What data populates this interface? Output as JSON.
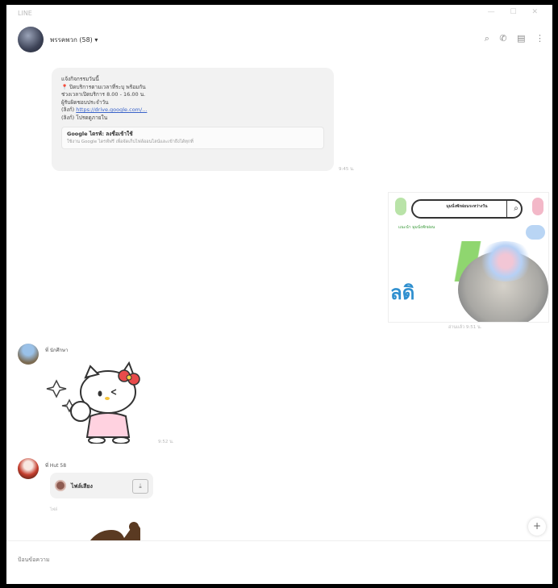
{
  "window": {
    "title": "LINE",
    "controls": "— ☐ ✕"
  },
  "header": {
    "chat_name": "พรรคพวก (58) ▾",
    "icons": [
      "search-icon",
      "phone-icon",
      "note-icon",
      "more-icon"
    ]
  },
  "messages": {
    "incoming_text": {
      "line1": "แจ้งกิจกรรมวันนี้",
      "line2": "📍 ปิดบริการตามเวลาที่ระบุ พร้อมกัน",
      "line3": "ช่วงเวลาเปิดบริการ 8.00 - 16.00 น.",
      "line4": "ผู้รับผิดชอบประจำวัน",
      "line5_prefix": "(ลิงก์) ",
      "link": "https://drive.google.com/...",
      "line6": "(ลิงก์) โปรดดูภายใน",
      "preview_title": "Google ไดรฟ์: ลงชื่อเข้าใช้",
      "preview_desc": "ใช้งาน Google ไดรฟ์ฟรี เพื่อจัดเก็บไฟล์ออนไลน์และเข้าถึงได้ทุกที่",
      "time": "9:45 น."
    },
    "image_post": {
      "search_text": "มุมนั่งพักผ่อนระหว่างวัน",
      "green_text": "แนะนำ มุมนั่งพักผ่อน",
      "big_text": "ลดิ",
      "read_time": "อ่านแล้ว 9:51 น."
    },
    "sticker_message": {
      "sender": "พี่ นักศึกษา",
      "time": "9:52 น."
    },
    "voice_message": {
      "sender": "พี่ Hut 58",
      "label": "ไฟล์เสียง",
      "sub": "ไฟล์"
    }
  },
  "composer": {
    "placeholder": "ป้อนข้อความ"
  },
  "colors": {
    "accent": "#3a63c9",
    "bubble": "#f2f2f2"
  }
}
